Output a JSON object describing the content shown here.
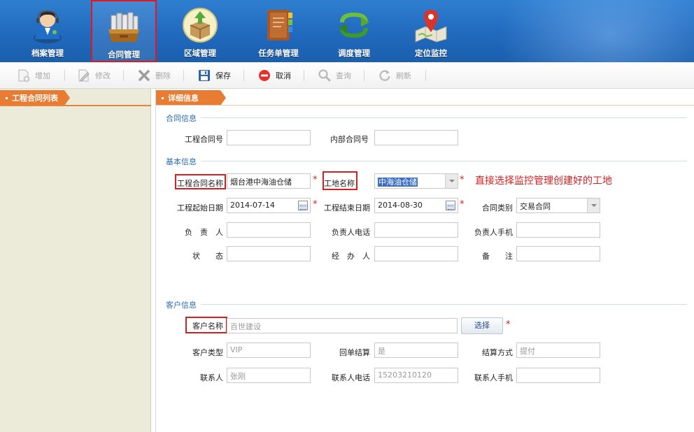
{
  "nav": {
    "items": [
      {
        "label": "档案管理",
        "icon": "user-profile-icon"
      },
      {
        "label": "合同管理",
        "icon": "contract-folder-icon",
        "active": true
      },
      {
        "label": "区域管理",
        "icon": "region-box-icon"
      },
      {
        "label": "任务单管理",
        "icon": "task-book-icon"
      },
      {
        "label": "调度管理",
        "icon": "dispatch-arrow-icon"
      },
      {
        "label": "定位监控",
        "icon": "map-pin-icon"
      }
    ]
  },
  "toolbar": {
    "add": "增加",
    "edit": "修改",
    "delete": "删除",
    "save": "保存",
    "cancel": "取消",
    "query": "查询",
    "refresh": "刷新"
  },
  "left_panel": {
    "title": "工程合同列表"
  },
  "detail": {
    "title": "详细信息",
    "contract_section": "合同信息",
    "basic_section": "基本信息",
    "customer_section": "客户信息",
    "fields": {
      "contract_no": {
        "label": "工程合同号",
        "value": ""
      },
      "internal_no": {
        "label": "内部合同号",
        "value": ""
      },
      "project_name": {
        "label": "工程合同名称",
        "value": "烟台港中海油仓储"
      },
      "site_name": {
        "label": "工地名称",
        "value": "中海油仓储"
      },
      "start_date": {
        "label": "工程起始日期",
        "value": "2014-07-14"
      },
      "end_date": {
        "label": "工程结束日期",
        "value": "2014-08-30"
      },
      "contract_type": {
        "label": "合同类别",
        "value": "交易合同"
      },
      "manager": {
        "label": "负　责　人",
        "value": ""
      },
      "manager_phone": {
        "label": "负责人电话",
        "value": ""
      },
      "manager_mobile": {
        "label": "负责人手机",
        "value": ""
      },
      "status": {
        "label": "状　　态",
        "value": ""
      },
      "handler": {
        "label": "经　办　人",
        "value": ""
      },
      "remark": {
        "label": "备　　注",
        "value": ""
      },
      "customer_name": {
        "label": "客户名称",
        "value": "百世建设"
      },
      "customer_type": {
        "label": "客户类型",
        "value": "VIP"
      },
      "settlement_per_order": {
        "label": "回单结算",
        "value": "是"
      },
      "settlement_method": {
        "label": "结算方式",
        "value": "提付"
      },
      "contact": {
        "label": "联系人",
        "value": "张刚"
      },
      "contact_phone": {
        "label": "联系人电话",
        "value": "15203210120"
      },
      "contact_mobile": {
        "label": "联系人手机",
        "value": ""
      }
    },
    "select_button": "选择",
    "required_mark": "*",
    "annotation": "直接选择监控管理创建好的工地"
  }
}
